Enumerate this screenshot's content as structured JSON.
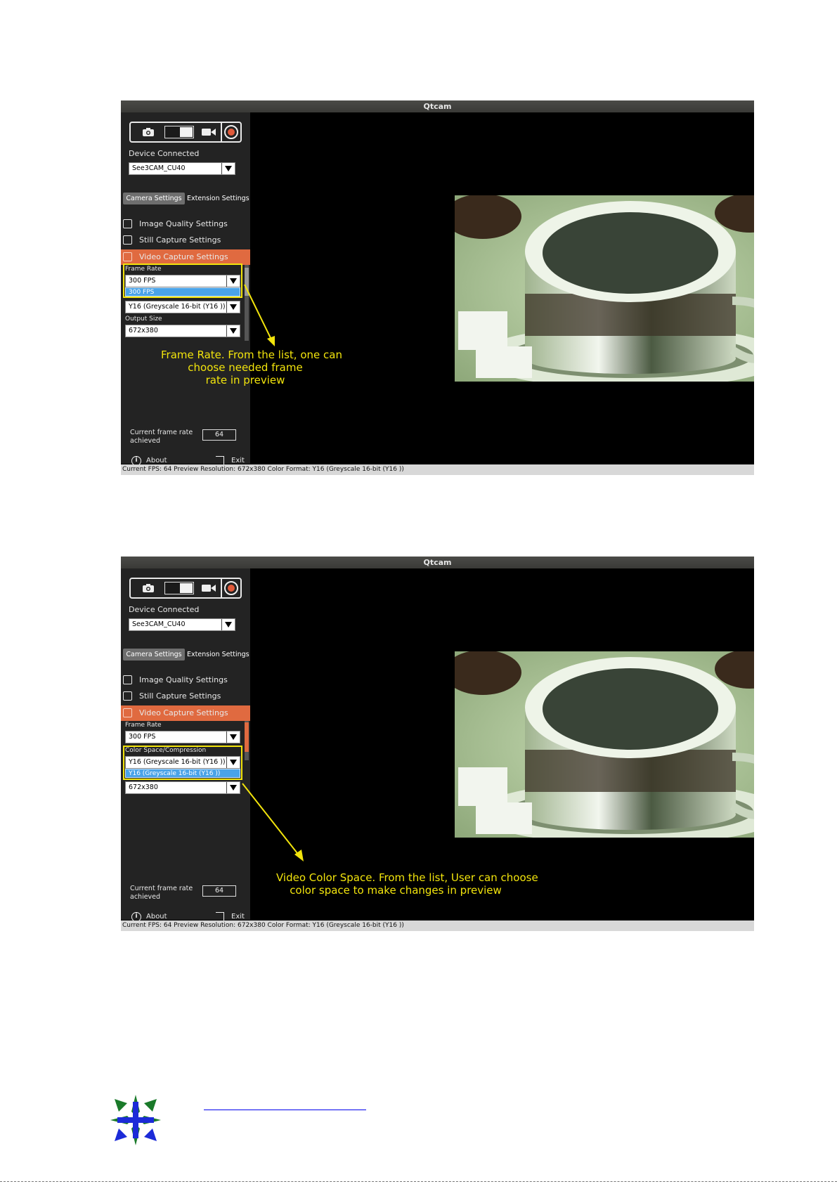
{
  "window": {
    "title": "Qtcam"
  },
  "sidebar": {
    "device_label": "Device Connected",
    "device_value": "See3CAM_CU40",
    "tabs": [
      "Camera Settings",
      "Extension Settings"
    ],
    "menu": [
      "Image Quality Settings",
      "Still Capture Settings",
      "Video Capture Settings"
    ],
    "frame_rate_label": "Frame Rate",
    "frame_rate_value": "300 FPS",
    "color_space_label": "Color Space/Compression",
    "color_space_value": "Y16  (Greyscale 16-bit (Y16 ))",
    "output_size_label": "Output Size",
    "output_size_value": "672x380",
    "current_frame_rate_label_1": "Current frame rate",
    "current_frame_rate_label_2": "achieved",
    "current_frame_rate_value": "64",
    "about": "About",
    "exit": "Exit",
    "collapse_glyph": "◂"
  },
  "statusbar": {
    "text": "Current FPS: 64 Preview Resolution: 672x380  Color Format: Y16  (Greyscale 16-bit (Y16 ))"
  },
  "screenshots": [
    {
      "dropdown_option": "300 FPS",
      "annotation": [
        "Frame Rate. From the list, one can",
        "choose needed frame",
        "rate in preview"
      ]
    },
    {
      "dropdown_option": "Y16  (Greyscale 16-bit (Y16 ))",
      "annotation": [
        "Video Color Space. From the list, User can choose",
        "color space to make changes in preview"
      ]
    }
  ],
  "colors": {
    "accent": "#e06a40",
    "highlight": "#f2e40c",
    "selection": "#4aa3e8",
    "panel": "#232323"
  },
  "icons": [
    "camera-icon",
    "video-camera-icon",
    "record-icon",
    "image-quality-icon",
    "still-capture-icon",
    "video-capture-icon",
    "dropdown-arrow-icon",
    "about-icon",
    "exit-icon",
    "collapse-panel-icon",
    "company-logo"
  ]
}
